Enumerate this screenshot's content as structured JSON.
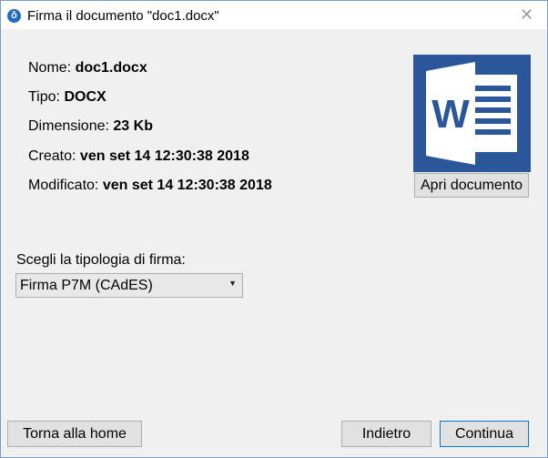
{
  "window": {
    "title": "Firma il documento \"doc1.docx\"",
    "app_icon": "ǒ",
    "close_glyph": "✕"
  },
  "info": {
    "name_label": "Nome:",
    "name_value": "doc1.docx",
    "type_label": "Tipo:",
    "type_value": "DOCX",
    "size_label": "Dimensione:",
    "size_value": "23 Kb",
    "created_label": "Creato:",
    "created_value": "ven set 14 12:30:38 2018",
    "modified_label": "Modificato:",
    "modified_value": "ven set 14 12:30:38 2018"
  },
  "document": {
    "icon": "word-document-icon",
    "icon_letter": "W",
    "icon_color": "#2b579a",
    "open_label": "Apri documento"
  },
  "signature": {
    "label": "Scegli la tipologia di firma:",
    "selected": "Firma P7M (CAdES)"
  },
  "footer": {
    "home_label": "Torna alla home",
    "back_label": "Indietro",
    "continue_label": "Continua"
  }
}
